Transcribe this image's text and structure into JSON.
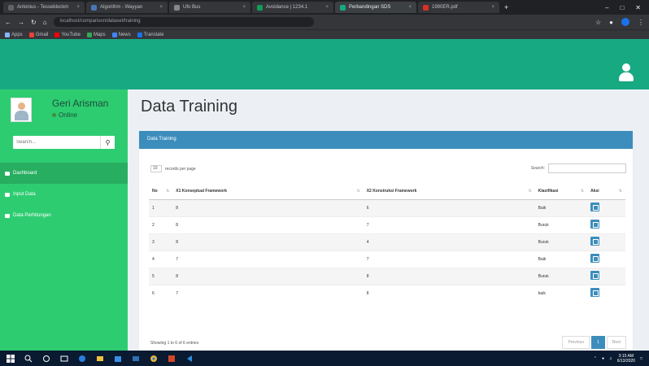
{
  "browser": {
    "tabs": [
      {
        "label": "Antonius - Tesseblockm",
        "color": "#5f6368",
        "active": false
      },
      {
        "label": "Algorithm - Wayyan",
        "color": "#4a76b8",
        "active": false
      },
      {
        "label": "Ufo Bus",
        "color": "#888888",
        "active": false
      },
      {
        "label": "Avoidance | 1234.1",
        "color": "#0f9d58",
        "active": false
      },
      {
        "label": "Perbandingan SDS",
        "color": "#17a982",
        "active": true
      },
      {
        "label": "1990ER.pdf",
        "color": "#d93025",
        "active": false
      }
    ],
    "url": "localhost/comparison/dataset/training",
    "bookmarks": [
      {
        "label": "Apps",
        "color": "#8ab4f8"
      },
      {
        "label": "Gmail",
        "color": "#ea4335"
      },
      {
        "label": "YouTube",
        "color": "#ff0000"
      },
      {
        "label": "Maps",
        "color": "#34a853"
      },
      {
        "label": "News",
        "color": "#4285f4"
      },
      {
        "label": "Translate",
        "color": "#1a73e8"
      }
    ]
  },
  "sidebar": {
    "user_name": "Geri Arisman",
    "status": "Online",
    "search_placeholder": "Search...",
    "items": [
      {
        "label": "Dashboard",
        "active": true
      },
      {
        "label": "Input Data",
        "active": false
      },
      {
        "label": "Data Perhitungan",
        "active": false
      }
    ]
  },
  "main": {
    "title": "Data Training",
    "box_title": "Data Training",
    "entries_value": "10",
    "entries_label": "records per page",
    "search_label": "Search:",
    "columns": [
      "No",
      "X1 Konseptual Framework",
      "X2 Konstruksi Framework",
      "Klasifikasi",
      "Aksi"
    ],
    "rows": [
      [
        "1",
        "8",
        "6",
        "Baik"
      ],
      [
        "2",
        "8",
        "7",
        "Buruk"
      ],
      [
        "3",
        "8",
        "4",
        "Buruk"
      ],
      [
        "4",
        "7",
        "7",
        "Baik"
      ],
      [
        "5",
        "8",
        "8",
        "Buruk"
      ],
      [
        "6",
        "7",
        "8",
        "baik"
      ]
    ],
    "info": "Showing 1 to 6 of 6 entries",
    "pager": {
      "previous": "Previous",
      "current": "1",
      "next": "Next"
    }
  },
  "taskbar": {
    "time": "3:15 AM",
    "date": "6/13/2020"
  }
}
